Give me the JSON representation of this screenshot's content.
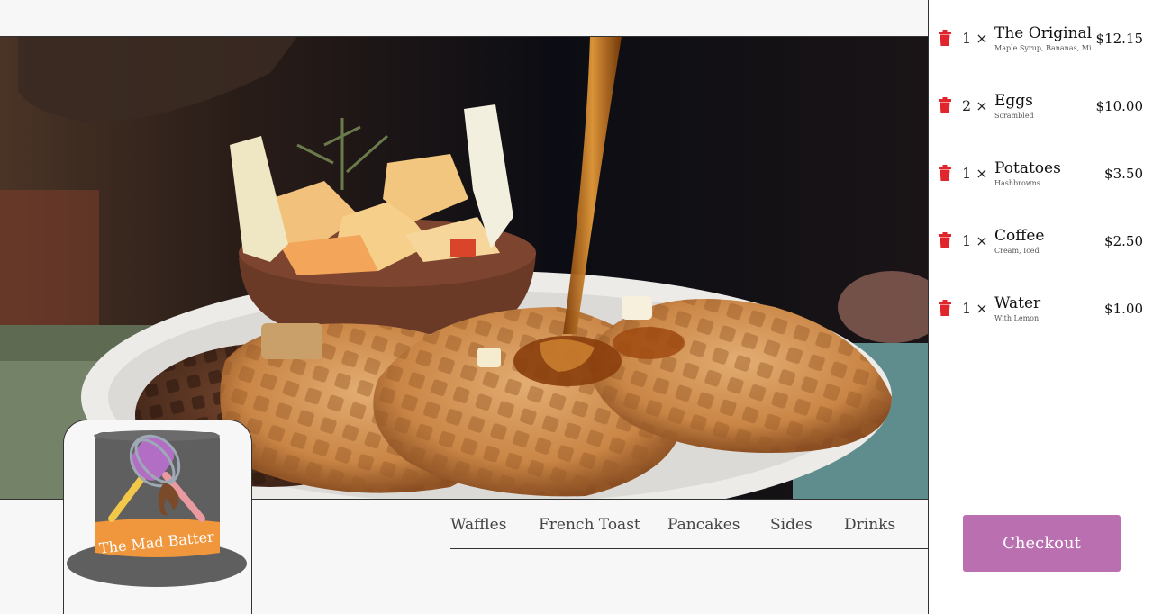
{
  "nav": {
    "items": [
      {
        "label": "Waffles"
      },
      {
        "label": "French Toast"
      },
      {
        "label": "Pancakes"
      },
      {
        "label": "Sides"
      },
      {
        "label": "Drinks"
      }
    ]
  },
  "logo": {
    "text": "The Mad Batter"
  },
  "cart": {
    "items": [
      {
        "quantity": "1 ×",
        "name": "The Original",
        "description": "Maple Syrup, Bananas, Mixed Fruit",
        "price": "$12.15"
      },
      {
        "quantity": "2 ×",
        "name": "Eggs",
        "description": "Scrambled",
        "price": "$10.00"
      },
      {
        "quantity": "1 ×",
        "name": "Potatoes",
        "description": "Hashbrowns",
        "price": "$3.50"
      },
      {
        "quantity": "1 ×",
        "name": "Coffee",
        "description": "Cream, Iced",
        "price": "$2.50"
      },
      {
        "quantity": "1 ×",
        "name": "Water",
        "description": "With Lemon",
        "price": "$1.00"
      }
    ],
    "checkout_label": "Checkout"
  },
  "icons": {
    "remove": "trash-icon"
  },
  "colors": {
    "accent": "#ba6fb0",
    "remove_icon": "#e0262c",
    "logo_band": "#f0963c",
    "hat": "#5f5f5f"
  }
}
